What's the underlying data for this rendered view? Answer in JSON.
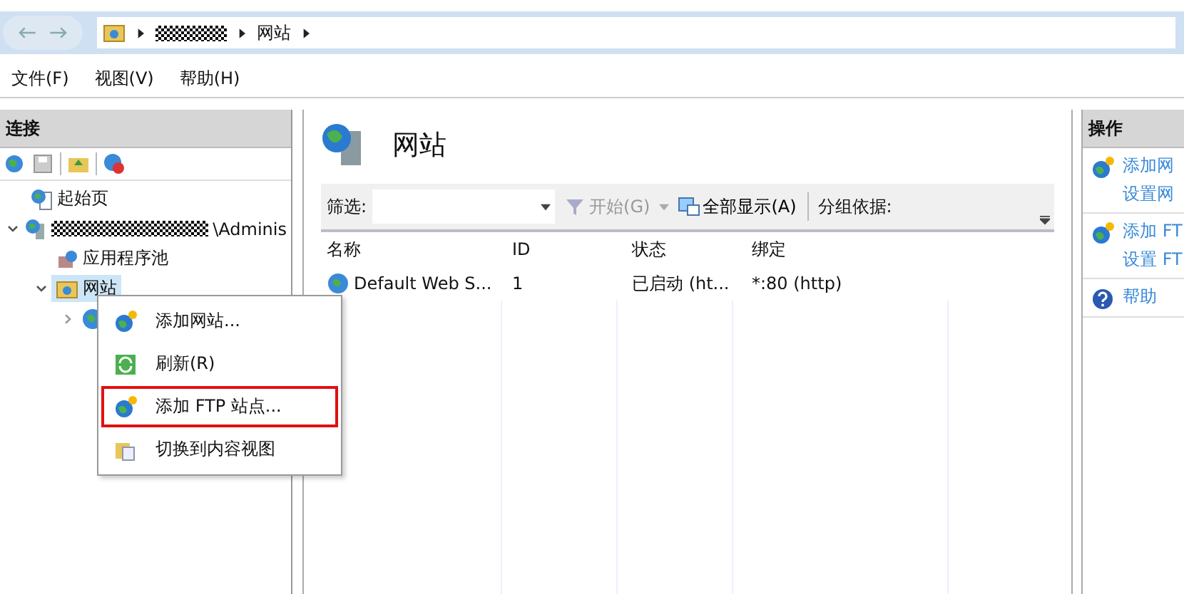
{
  "address_bar": {
    "crumbs": [
      {
        "kind": "redacted"
      },
      {
        "kind": "text",
        "label": "网站"
      }
    ]
  },
  "menu_bar": [
    "文件(F)",
    "视图(V)",
    "帮助(H)"
  ],
  "connections": {
    "title": "连接",
    "tree": [
      {
        "label": "起始页",
        "kind": "start",
        "selected": false
      },
      {
        "label": "\\Adminis",
        "kind": "server",
        "redacted": true,
        "selected": false,
        "expanded": true,
        "children": [
          {
            "label": "应用程序池",
            "kind": "pool",
            "selected": false
          },
          {
            "label": "网站",
            "kind": "folder",
            "selected": true,
            "expanded": true,
            "children": [
              {
                "kind": "globe",
                "selected": false,
                "expanded": false
              }
            ]
          }
        ]
      }
    ]
  },
  "content": {
    "title": "网站",
    "filter": {
      "label": "筛选:",
      "start": "开始(G)",
      "show_all": "全部显示(A)",
      "group_by": "分组依据:"
    },
    "table": {
      "columns": [
        "名称",
        "ID",
        "状态",
        "绑定"
      ],
      "rows": [
        [
          "Default Web S...",
          "1",
          "已启动 (ht...",
          "*:80 (http)"
        ]
      ]
    }
  },
  "actions": {
    "title": "操作",
    "groups": [
      {
        "kind": "globe-add",
        "items": [
          "添加网",
          "设置网"
        ]
      },
      {
        "kind": "globe-add",
        "items": [
          "添加 FT",
          "设置 FT"
        ]
      },
      {
        "kind": "help",
        "items": [
          "帮助"
        ]
      }
    ]
  },
  "context_menu": {
    "items": [
      {
        "label": "添加网站...",
        "kind": "globe-add",
        "highlighted": false
      },
      {
        "label": "刷新(R)",
        "kind": "refresh",
        "highlighted": false
      },
      {
        "label": "添加 FTP 站点...",
        "kind": "globe-add",
        "highlighted": true
      },
      {
        "label": "切换到内容视图",
        "kind": "content",
        "highlighted": false
      }
    ]
  }
}
